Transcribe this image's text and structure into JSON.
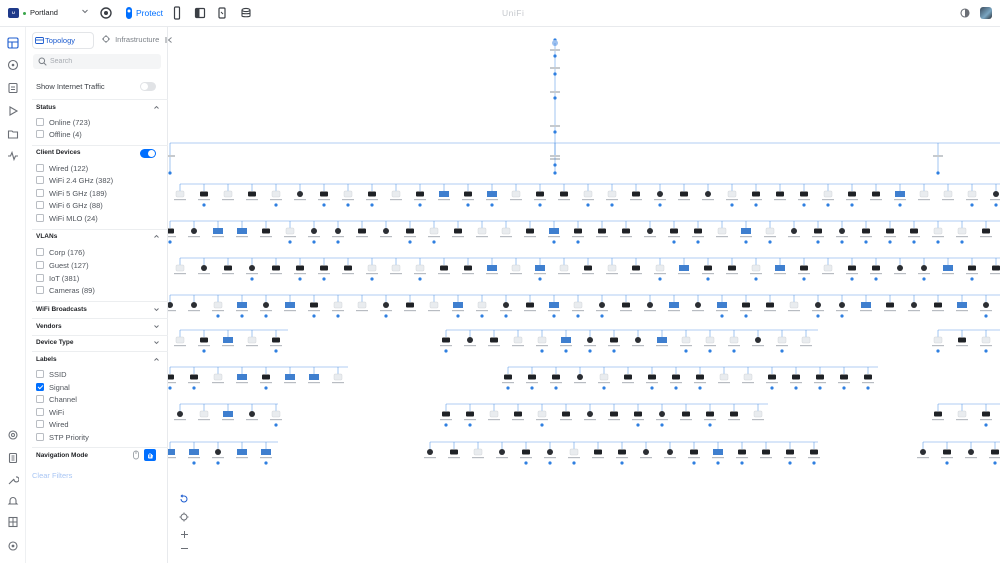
{
  "topbar": {
    "site_logo_text": "U",
    "site_name": "Portland",
    "protect_label": "Protect",
    "brand": "UniFi"
  },
  "panel": {
    "tabs": {
      "topology": "Topology",
      "infrastructure": "Infrastructure"
    },
    "search_placeholder": "Search",
    "show_internet_label": "Show Internet Traffic",
    "status": {
      "title": "Status",
      "items": [
        "Online (723)",
        "Offline (4)"
      ]
    },
    "client_devices": {
      "title": "Client Devices",
      "items": [
        "Wired (122)",
        "WiFi 2.4 GHz (382)",
        "WiFi 5 GHz (189)",
        "WiFi 6 GHz (88)",
        "WiFi MLO (24)"
      ]
    },
    "vlans": {
      "title": "VLANs",
      "items": [
        "Corp (176)",
        "Guest (127)",
        "IoT (381)",
        "Cameras (89)"
      ]
    },
    "wifi_broadcasts": "WiFi Broadcasts",
    "vendors": "Vendors",
    "device_type": "Device Type",
    "labels": {
      "title": "Labels",
      "items": [
        "SSID",
        "Signal",
        "Channel",
        "WiFi",
        "Wired",
        "STP Priority"
      ],
      "checked": [
        false,
        true,
        false,
        false,
        false,
        false
      ]
    },
    "navigation_mode": "Navigation Mode",
    "clear_filters": "Clear Filters"
  },
  "colors": {
    "accent": "#006fff",
    "link_line": "#2f7fe0",
    "node_dot": "#2f7fe0"
  },
  "icons": {
    "rail": [
      "dashboard-icon",
      "topology-icon",
      "devices-icon",
      "insights-icon",
      "files-icon",
      "activity-icon",
      "settings-icon",
      "logs-icon",
      "tools-icon",
      "alerts-icon",
      "system-icon",
      "account-icon"
    ]
  }
}
